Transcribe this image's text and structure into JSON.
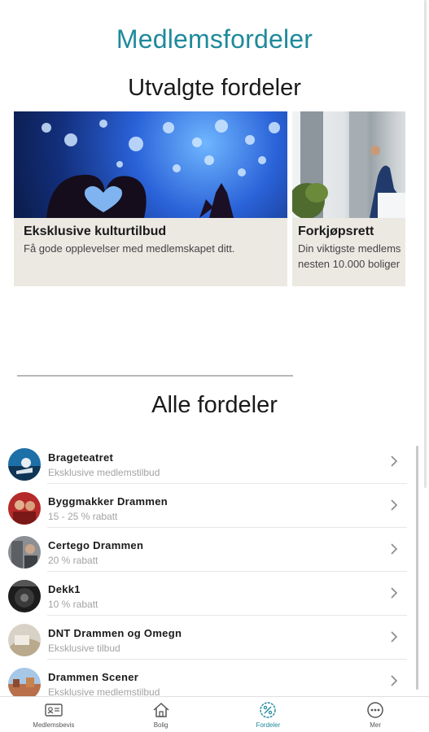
{
  "page": {
    "title": "Medlemsfordeler"
  },
  "featured": {
    "title": "Utvalgte fordeler",
    "cards": [
      {
        "title": "Eksklusive kulturtilbud",
        "desc_lines": [
          "Få gode opplevelser med medlemskapet ditt."
        ]
      },
      {
        "title": "Forkjøpsrett",
        "desc_lines": [
          "Din viktigste medlems",
          "nesten 10.000 boliger"
        ]
      }
    ]
  },
  "all": {
    "title": "Alle fordeler",
    "items": [
      {
        "name": "Brageteatret",
        "sub": "Eksklusive medlemstilbud"
      },
      {
        "name": "Byggmakker Drammen",
        "sub": "15 - 25 % rabatt"
      },
      {
        "name": "Certego Drammen",
        "sub": "20 % rabatt"
      },
      {
        "name": "Dekk1",
        "sub": "10 % rabatt"
      },
      {
        "name": "DNT Drammen og Omegn",
        "sub": "Eksklusive tilbud"
      },
      {
        "name": "Drammen Scener",
        "sub": "Eksklusive medlemstilbud"
      }
    ]
  },
  "tabbar": {
    "tabs": [
      {
        "label": "Medlemsbevis",
        "icon": "membership-card-icon"
      },
      {
        "label": "Bolig",
        "icon": "home-icon"
      },
      {
        "label": "Fordeler",
        "icon": "percent-badge-icon",
        "active": true
      },
      {
        "label": "Mer",
        "icon": "more-icon"
      }
    ]
  },
  "colors": {
    "accent": "#1f8a9c",
    "card_bg": "#ece9e3",
    "subtext": "#a3a3a3"
  }
}
